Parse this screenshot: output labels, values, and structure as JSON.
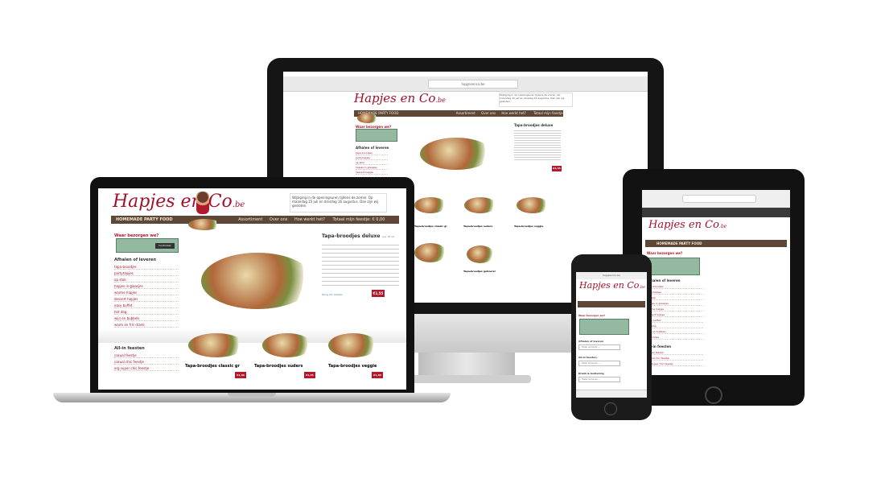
{
  "brand": {
    "logo": "Hapjes en Co",
    "logo_suffix": ".be",
    "tagline": "HOMEMADE PARTY FOOD"
  },
  "nav": {
    "items": [
      "Assortiment",
      "Over ons",
      "Hoe werkt het?"
    ],
    "cart": "Totaal mijn feestje: € 0,00"
  },
  "notice": "Wijziging in de openingsuren tijdens de zomer. Op maandag 15 juli en dinsdag 16 augustus. Dan zijn wij gesloten.",
  "sidebar": {
    "where_title": "Waar bezorgen we?",
    "check_label": "Controleer",
    "section1": "Afhalen of leveren",
    "items1": [
      "tapa-broodjes",
      "partyhapjes",
      "op stok",
      "hapjes in glaasjes",
      "warme hapjes",
      "dessert hapjes",
      "easy buffet",
      "hot dog",
      "wijn en bubbels",
      "warm en fris drank",
      "promoties",
      "baby-borrel"
    ],
    "section2": "All-in feesten",
    "items2": [
      "casual feestje",
      "casual chic feestje",
      "erg super chic feestje"
    ]
  },
  "product": {
    "title": "Tapa-broodjes deluxe",
    "subtitle": "(per 48 st)",
    "price": "€1,55",
    "link": "Terug tot: Details"
  },
  "cards": [
    {
      "title": "Tapa-broodjes classic gr",
      "subtitle": "(per 48 st)",
      "price": "€1,30"
    },
    {
      "title": "Tapa-broodjes suders",
      "subtitle": "(per 48 st)",
      "price": "€1,65"
    },
    {
      "title": "Tapa-broodjes veggie",
      "subtitle": "(per 48 st)",
      "price": "€1,60"
    }
  ],
  "extra_card": "Tapa-broodjes gehoorsl",
  "phone": {
    "url": "hapjesenco.be",
    "section1": "Afhalen of leveren",
    "section2": "All-in feesten",
    "section3": "Drank & bediening",
    "select": "— Maak uw keuze —"
  },
  "browser": {
    "url": "hapjesenco.be"
  },
  "colors": {
    "brand_red": "#a3102a",
    "bar_brown": "#5e4737",
    "accent_green": "#93b9a0"
  }
}
